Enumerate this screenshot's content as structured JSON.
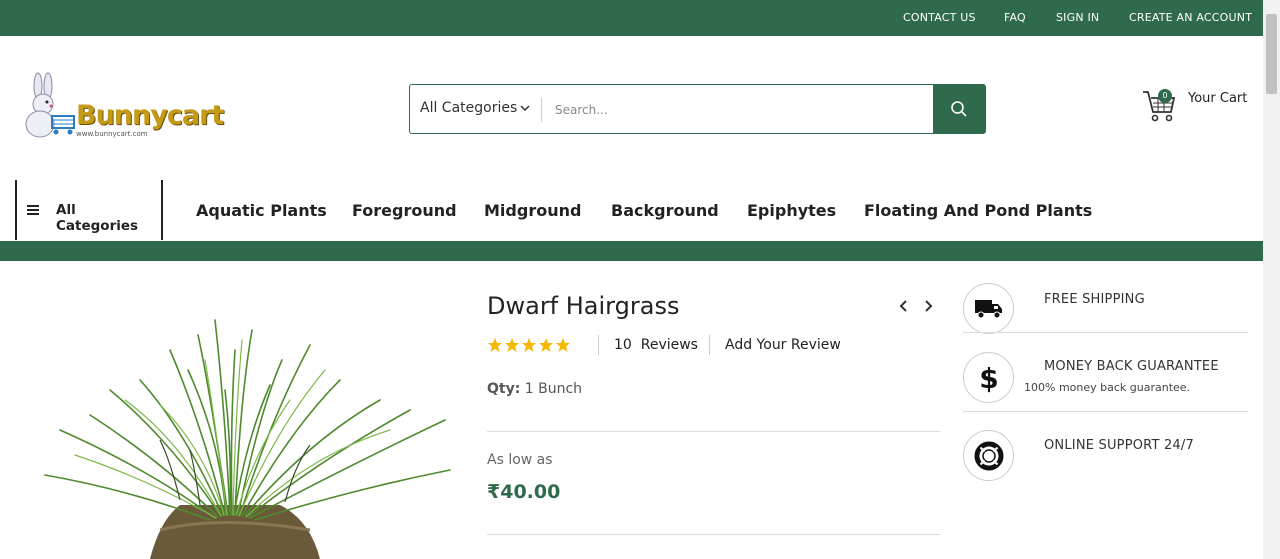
{
  "topbar": {
    "links": [
      "CONTACT US",
      "FAQ",
      "SIGN IN",
      "CREATE AN ACCOUNT"
    ]
  },
  "logo": {
    "text": "Bunnycart",
    "subtext": "www.bunnycart.com"
  },
  "search": {
    "category": "All Categories",
    "placeholder": "Search...",
    "value": ""
  },
  "cart": {
    "count": "0",
    "label": "Your Cart"
  },
  "nav": {
    "all_categories": "All Categories",
    "items": [
      "Aquatic Plants",
      "Foreground",
      "Midground",
      "Background",
      "Epiphytes",
      "Floating And Pond Plants"
    ]
  },
  "product": {
    "title": "Dwarf Hairgrass",
    "rating_stars": 5,
    "reviews_count": "10",
    "reviews_label": "Reviews",
    "add_review": "Add Your Review",
    "qty_label": "Qty:",
    "qty_value": "1 Bunch",
    "as_low_as": "As low as",
    "price": "₹40.00"
  },
  "features": [
    {
      "title": "FREE SHIPPING",
      "subtitle": "",
      "icon": "truck-icon"
    },
    {
      "title": "MONEY BACK GUARANTEE",
      "subtitle": "100% money back guarantee.",
      "icon": "dollar-icon"
    },
    {
      "title": "ONLINE SUPPORT 24/7",
      "subtitle": "",
      "icon": "lifebuoy-icon"
    }
  ],
  "colors": {
    "brand_green": "#2f6a4c",
    "star_gold": "#f5b800",
    "logo_gold": "#c59a17"
  }
}
